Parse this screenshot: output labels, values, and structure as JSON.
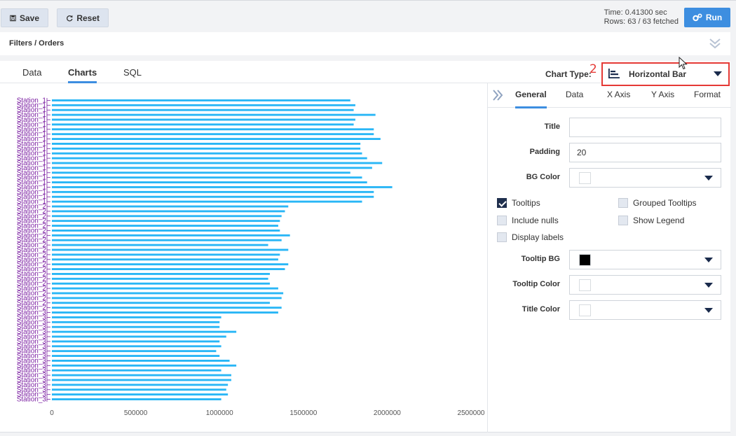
{
  "toolbar": {
    "save_label": "Save",
    "reset_label": "Reset",
    "time_text": "Time: 0.41300 sec",
    "rows_text": "Rows: 63 / 63 fetched",
    "run_label": "Run"
  },
  "filters": {
    "label": "Filters / Orders"
  },
  "tabs": [
    {
      "label": "Data"
    },
    {
      "label": "Charts"
    },
    {
      "label": "SQL"
    }
  ],
  "chart_type": {
    "label": "Chart Type:",
    "annotation": "2",
    "value": "Horizontal Bar"
  },
  "settings": {
    "tabs": [
      {
        "label": "General"
      },
      {
        "label": "Data"
      },
      {
        "label": "X Axis"
      },
      {
        "label": "Y Axis"
      },
      {
        "label": "Format"
      }
    ],
    "title_label": "Title",
    "title_value": "",
    "padding_label": "Padding",
    "padding_value": "20",
    "bg_color_label": "BG Color",
    "bg_color": "#ffffff",
    "tooltips_label": "Tooltips",
    "grouped_tooltips_label": "Grouped Tooltips",
    "include_nulls_label": "Include nulls",
    "show_legend_label": "Show Legend",
    "display_labels_label": "Display labels",
    "tooltip_bg_label": "Tooltip BG",
    "tooltip_bg_color": "#000000",
    "tooltip_color_label": "Tooltip Color",
    "tooltip_color": "#ffffff",
    "title_color_label": "Title Color",
    "title_color": "#ffffff",
    "checks": {
      "tooltips": true,
      "grouped_tooltips": false,
      "include_nulls": false,
      "show_legend": false,
      "display_labels": false
    }
  },
  "colors": {
    "accent": "#3d8ee0",
    "bar": "#29b6f6",
    "label": "#7b1fa2",
    "highlight": "#e53935"
  },
  "chart_data": {
    "type": "bar",
    "orientation": "horizontal",
    "title": "",
    "xlabel": "",
    "ylabel": "",
    "xlim": [
      0,
      2500000
    ],
    "xticks": [
      "0",
      "500000",
      "1000000",
      "1500000",
      "2000000",
      "2500000"
    ],
    "grid": false,
    "categories": [
      "Station_1",
      "Station_1",
      "Station_1",
      "Station_1",
      "Station_1",
      "Station_1",
      "Station_1",
      "Station_1",
      "Station_1",
      "Station_1",
      "Station_1",
      "Station_1",
      "Station_1",
      "Station_1",
      "Station_1",
      "Station_1",
      "Station_1",
      "Station_1",
      "Station_1",
      "Station_1",
      "Station_1",
      "Station_1",
      "Station_2",
      "Station_2",
      "Station_2",
      "Station_2",
      "Station_2",
      "Station_2",
      "Station_2",
      "Station_2",
      "Station_2",
      "Station_2",
      "Station_2",
      "Station_2",
      "Station_2",
      "Station_2",
      "Station_2",
      "Station_2",
      "Station_2",
      "Station_2",
      "Station_2",
      "Station_2",
      "Station_2",
      "Station_2",
      "Station_3",
      "Station_3",
      "Station_3",
      "Station_3",
      "Station_3",
      "Station_3",
      "Station_3",
      "Station_3",
      "Station_3",
      "Station_3",
      "Station_3",
      "Station_3",
      "Station_3",
      "Station_3",
      "Station_3",
      "Station_3",
      "Station_3",
      "Station_3",
      "Station_3"
    ],
    "values": [
      1780000,
      1810000,
      1800000,
      1930000,
      1810000,
      1800000,
      1920000,
      1920000,
      1960000,
      1840000,
      1840000,
      1850000,
      1880000,
      1970000,
      1910000,
      1780000,
      1850000,
      1880000,
      2030000,
      1920000,
      1920000,
      1850000,
      1410000,
      1390000,
      1370000,
      1360000,
      1350000,
      1360000,
      1420000,
      1370000,
      1290000,
      1410000,
      1360000,
      1350000,
      1410000,
      1390000,
      1300000,
      1290000,
      1300000,
      1350000,
      1380000,
      1370000,
      1300000,
      1370000,
      1350000,
      1010000,
      1000000,
      1000000,
      1100000,
      1040000,
      1000000,
      1010000,
      980000,
      1000000,
      1060000,
      1100000,
      1010000,
      1070000,
      1070000,
      1050000,
      1040000,
      1050000,
      1010000
    ]
  }
}
